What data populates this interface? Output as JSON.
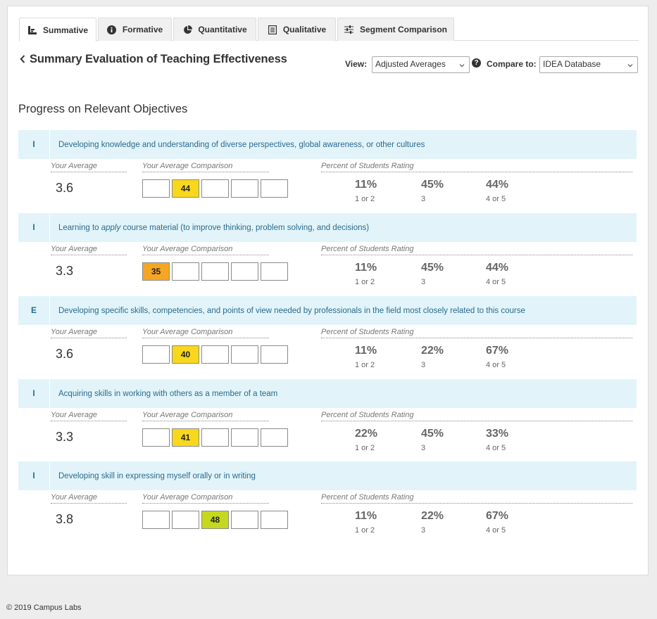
{
  "tabs": [
    {
      "label": "Summative",
      "icon": "bar-chart-icon",
      "active": true
    },
    {
      "label": "Formative",
      "icon": "info-icon",
      "active": false
    },
    {
      "label": "Quantitative",
      "icon": "pie-chart-icon",
      "active": false
    },
    {
      "label": "Qualitative",
      "icon": "document-icon",
      "active": false
    },
    {
      "label": "Segment Comparison",
      "icon": "sliders-icon",
      "active": false
    }
  ],
  "page_title": "Summary Evaluation of Teaching Effectiveness",
  "view": {
    "label": "View:",
    "value": "Adjusted Averages"
  },
  "compare": {
    "label": "Compare to:",
    "value": "IDEA Database"
  },
  "section_title": "Progress on Relevant Objectives",
  "column_headers": {
    "your_average": "Your Average",
    "comparison": "Your Average Comparison",
    "percent": "Percent of Students Rating"
  },
  "rating_labels": [
    "1 or 2",
    "3",
    "4 or 5"
  ],
  "box_colors": {
    "yellow": "#f9d71c",
    "orange": "#f6a623",
    "green": "#c5d81f"
  },
  "objectives": [
    {
      "badge": "I",
      "text": "Developing knowledge and understanding of diverse perspectives, global awareness, or other cultures",
      "average": "3.6",
      "comparison": "44",
      "box_index": 1,
      "box_color": "#f9d71c",
      "pcts": [
        "11%",
        "45%",
        "44%"
      ]
    },
    {
      "badge": "I",
      "text_before": "Learning to ",
      "text_em": "apply",
      "text_after": " course material (to improve thinking, problem solving, and decisions)",
      "average": "3.3",
      "comparison": "35",
      "box_index": 0,
      "box_color": "#f6a623",
      "pcts": [
        "11%",
        "45%",
        "44%"
      ]
    },
    {
      "badge": "E",
      "text": "Developing specific skills, competencies, and points of view needed by professionals in the field most closely related to this course",
      "average": "3.6",
      "comparison": "40",
      "box_index": 1,
      "box_color": "#f9d71c",
      "pcts": [
        "11%",
        "22%",
        "67%"
      ]
    },
    {
      "badge": "I",
      "text": "Acquiring skills in working with others as a member of a team",
      "average": "3.3",
      "comparison": "41",
      "box_index": 1,
      "box_color": "#f9d71c",
      "pcts": [
        "22%",
        "45%",
        "33%"
      ]
    },
    {
      "badge": "I",
      "text": "Developing skill in expressing myself orally or in writing",
      "average": "3.8",
      "comparison": "48",
      "box_index": 2,
      "box_color": "#c5d81f",
      "pcts": [
        "11%",
        "22%",
        "67%"
      ]
    }
  ],
  "footer": "© 2019 Campus Labs"
}
